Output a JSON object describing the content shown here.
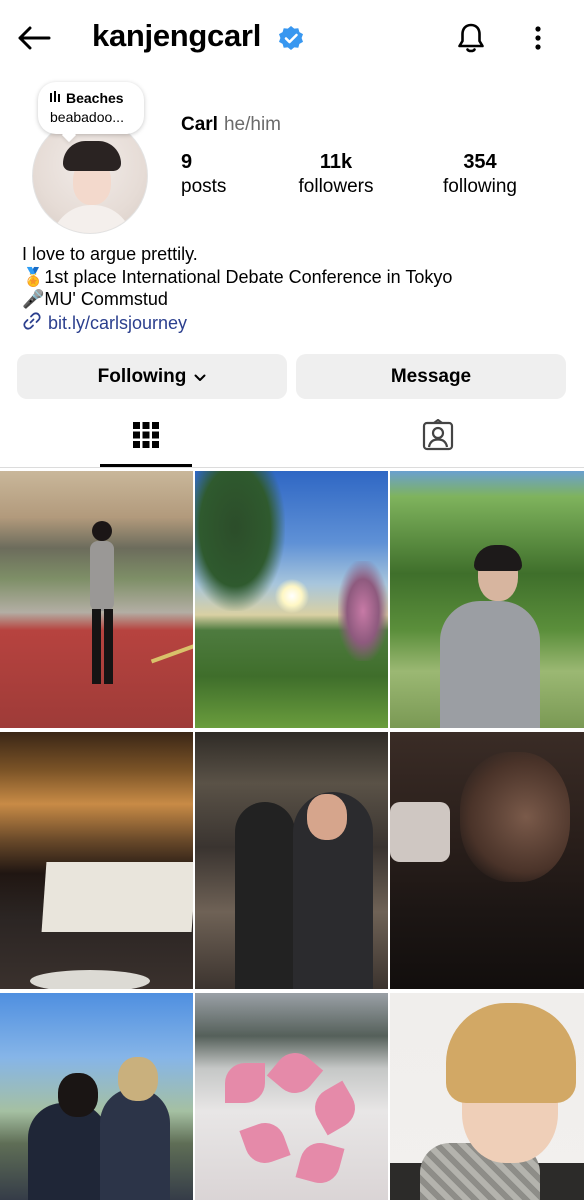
{
  "header": {
    "username": "kanjengcarl",
    "verified": true,
    "icons": [
      "back-arrow-icon",
      "verified-badge-icon",
      "bell-icon",
      "more-vertical-icon"
    ]
  },
  "profile": {
    "note": {
      "line1": "Beaches",
      "line2": "beabadoo..."
    },
    "display_name": "Carl",
    "pronouns": "he/him",
    "stats": {
      "posts": {
        "value": "9",
        "label": "posts"
      },
      "followers": {
        "value": "11k",
        "label": "followers"
      },
      "following": {
        "value": "354",
        "label": "following"
      }
    },
    "bio": {
      "line1": "I love to argue prettily.",
      "line2_emoji": "🏅",
      "line2": "1st place International Debate Conference in Tokyo",
      "line3_emoji": "🎤",
      "line3": "MU' Commstud",
      "link": "bit.ly/carlsjourney"
    }
  },
  "actions": {
    "following_label": "Following",
    "message_label": "Message"
  },
  "tabs": [
    {
      "icon": "grid-icon",
      "active": true
    },
    {
      "icon": "tagged-person-icon",
      "active": false
    }
  ],
  "colors": {
    "accent_link": "#2b3f8e",
    "verified_badge": "#3897f0",
    "button_bg": "#efefef"
  },
  "posts": [
    {
      "subject": "person standing on red road under a bridge"
    },
    {
      "subject": "sunset over green hills with trees"
    },
    {
      "subject": "person in grey cardigan in green park"
    },
    {
      "subject": "orchestra in an opera house"
    },
    {
      "subject": "two men posing in a restaurant"
    },
    {
      "subject": "dark close-up selfie"
    },
    {
      "subject": "two boys in school uniforms outdoors"
    },
    {
      "subject": "bouquet of pink lilies"
    },
    {
      "subject": "blonde selfie with scarf"
    }
  ]
}
